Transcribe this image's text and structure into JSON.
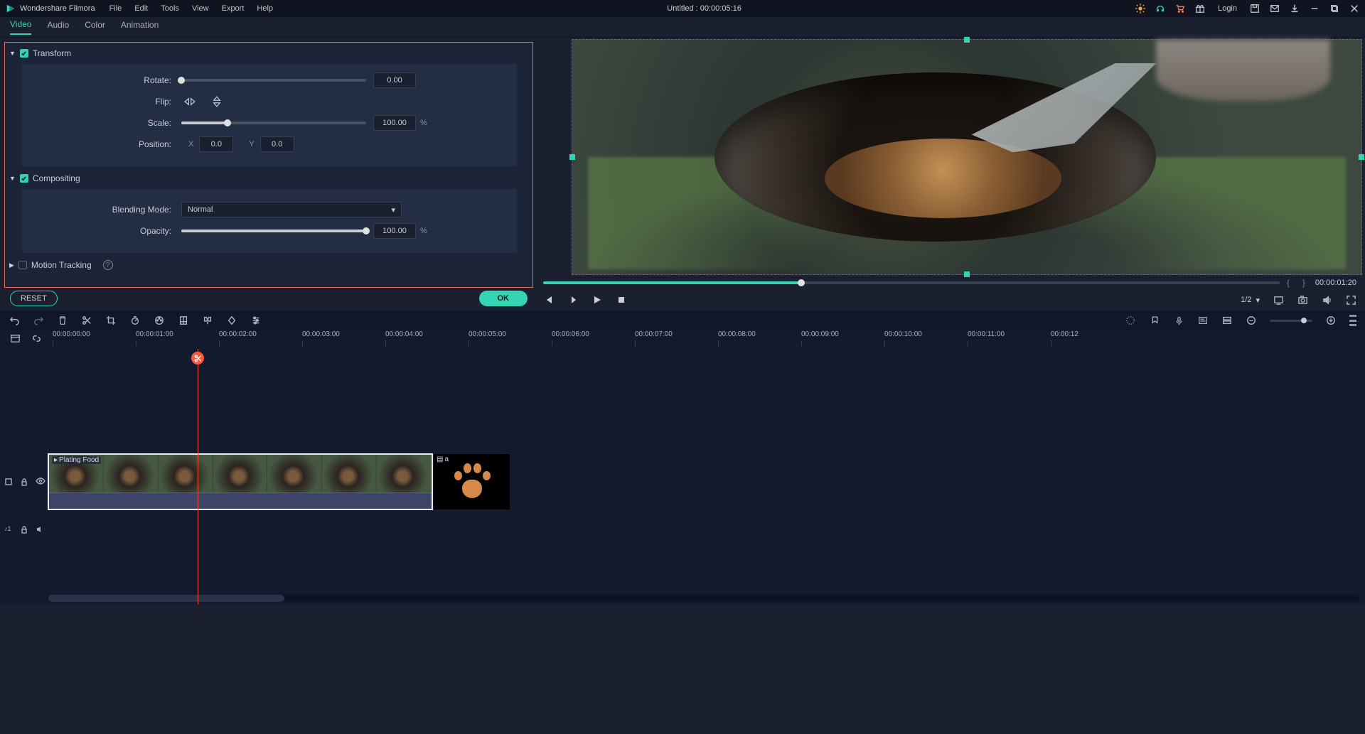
{
  "titlebar": {
    "app_name": "Wondershare Filmora",
    "menu": [
      "File",
      "Edit",
      "Tools",
      "View",
      "Export",
      "Help"
    ],
    "doc_title": "Untitled : 00:00:05:16",
    "login": "Login"
  },
  "tabs": {
    "items": [
      "Video",
      "Audio",
      "Color",
      "Animation"
    ]
  },
  "props": {
    "transform": {
      "title": "Transform",
      "rotate_label": "Rotate:",
      "rotate_value": "0.00",
      "flip_label": "Flip:",
      "scale_label": "Scale:",
      "scale_value": "100.00",
      "scale_unit": "%",
      "position_label": "Position:",
      "pos_x_label": "X",
      "pos_x_value": "0.0",
      "pos_y_label": "Y",
      "pos_y_value": "0.0"
    },
    "compositing": {
      "title": "Compositing",
      "blend_label": "Blending Mode:",
      "blend_value": "Normal",
      "opacity_label": "Opacity:",
      "opacity_value": "100.00",
      "opacity_unit": "%"
    },
    "motion_tracking": {
      "title": "Motion Tracking"
    }
  },
  "buttons": {
    "reset": "RESET",
    "ok": "OK"
  },
  "preview": {
    "time": "00:00:01:20",
    "zoom": "1/2"
  },
  "timeline": {
    "ticks": [
      "00:00:00:00",
      "00:00:01:00",
      "00:00:02:00",
      "00:00:03:00",
      "00:00:04:00",
      "00:00:05:00",
      "00:00:06:00",
      "00:00:07:00",
      "00:00:08:00",
      "00:00:09:00",
      "00:00:10:00",
      "00:00:11:00",
      "00:00:12"
    ],
    "clip1_name": "Plating Food",
    "clip2_name": "a"
  }
}
